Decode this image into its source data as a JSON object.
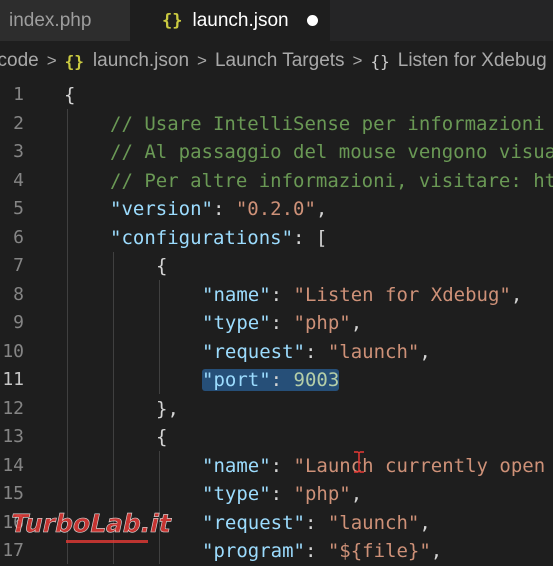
{
  "tabs": [
    {
      "label": "index.php",
      "active": false
    },
    {
      "label": "launch.json",
      "active": true,
      "icon": "{}",
      "dirty": true
    }
  ],
  "breadcrumb": {
    "items": [
      "scode",
      "launch.json",
      "Launch Targets",
      "Listen for Xdebug"
    ],
    "json_icon": "{}",
    "object_icon": "{}",
    "separator": ">"
  },
  "editor": {
    "active_line": 11,
    "selected_text": "\"port\": 9003",
    "line_numbers": [
      "1",
      "2",
      "3",
      "4",
      "5",
      "6",
      "7",
      "8",
      "9",
      "10",
      "11",
      "12",
      "13",
      "14",
      "15",
      "16",
      "17"
    ],
    "lines": [
      [
        {
          "t": "{",
          "c": "punc"
        }
      ],
      [
        {
          "t": "// Usare IntelliSense per informazioni",
          "c": "comment"
        }
      ],
      [
        {
          "t": "// Al passaggio del mouse vengono visua",
          "c": "comment"
        }
      ],
      [
        {
          "t": "// Per altre informazioni, visitare: ht",
          "c": "comment"
        }
      ],
      [
        {
          "t": "\"version\"",
          "c": "key"
        },
        {
          "t": ": ",
          "c": "punc"
        },
        {
          "t": "\"0.2.0\"",
          "c": "str"
        },
        {
          "t": ",",
          "c": "punc"
        }
      ],
      [
        {
          "t": "\"configurations\"",
          "c": "key"
        },
        {
          "t": ": [",
          "c": "punc"
        }
      ],
      [
        {
          "t": "{",
          "c": "punc"
        }
      ],
      [
        {
          "t": "\"name\"",
          "c": "key"
        },
        {
          "t": ": ",
          "c": "punc"
        },
        {
          "t": "\"Listen for Xdebug\"",
          "c": "str"
        },
        {
          "t": ",",
          "c": "punc"
        }
      ],
      [
        {
          "t": "\"type\"",
          "c": "key"
        },
        {
          "t": ": ",
          "c": "punc"
        },
        {
          "t": "\"php\"",
          "c": "str"
        },
        {
          "t": ",",
          "c": "punc"
        }
      ],
      [
        {
          "t": "\"request\"",
          "c": "key"
        },
        {
          "t": ": ",
          "c": "punc"
        },
        {
          "t": "\"launch\"",
          "c": "str"
        },
        {
          "t": ",",
          "c": "punc"
        }
      ],
      [
        {
          "t": "\"port\"",
          "c": "key",
          "sel": true
        },
        {
          "t": ": ",
          "c": "punc",
          "sel": true
        },
        {
          "t": "9003",
          "c": "num",
          "sel": true
        }
      ],
      [
        {
          "t": "},",
          "c": "punc"
        }
      ],
      [
        {
          "t": "{",
          "c": "punc"
        }
      ],
      [
        {
          "t": "\"name\"",
          "c": "key"
        },
        {
          "t": ": ",
          "c": "punc"
        },
        {
          "t": "\"Launch currently open",
          "c": "str"
        }
      ],
      [
        {
          "t": "\"type\"",
          "c": "key"
        },
        {
          "t": ": ",
          "c": "punc"
        },
        {
          "t": "\"php\"",
          "c": "str"
        },
        {
          "t": ",",
          "c": "punc"
        }
      ],
      [
        {
          "t": "\"request\"",
          "c": "key"
        },
        {
          "t": ": ",
          "c": "punc"
        },
        {
          "t": "\"launch\"",
          "c": "str"
        },
        {
          "t": ",",
          "c": "punc"
        }
      ],
      [
        {
          "t": "\"program\"",
          "c": "key"
        },
        {
          "t": ": ",
          "c": "punc"
        },
        {
          "t": "\"${file}\"",
          "c": "str"
        },
        {
          "t": ",",
          "c": "punc"
        }
      ]
    ]
  },
  "watermark": {
    "text": "TurboLab.it"
  },
  "colors": {
    "comment": "#6a9955",
    "key": "#9cdcfe",
    "string": "#ce9178",
    "number": "#b5cea8",
    "selection": "#264f78",
    "json_icon": "#cbcb41",
    "watermark": "#e53935"
  }
}
